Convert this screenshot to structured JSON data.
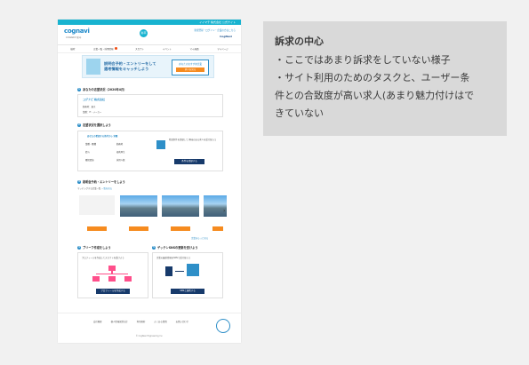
{
  "header": {
    "top_strip": "イイマチ 株式会社 公式サイト",
    "logo": "cognavi",
    "logo_badge": "新卒",
    "logo_sub": "COGNAVI 新卒",
    "info_text": "新規登録・ログイン・企業の方はこちら",
    "right_logo": "CogNavi",
    "nav_items": [
      "検索",
      "企業一覧・採用情報",
      "スカウト",
      "イベント",
      "マイ画面",
      "マイページ"
    ]
  },
  "hero": {
    "line1": "説明会予約・エントリーをして",
    "line2": "選考情報をキャッチしよう",
    "box_label": "あなたのおすすめ企業",
    "button": "求人を見る"
  },
  "sections": {
    "s1": "あなたの志望状況（2020年4月）",
    "s1_company": "コグナビ 株式会社",
    "s1_row1": "勤務地：東京",
    "s1_row2": "業種：IT・メーカー",
    "s2": "志望状況を選択しよう",
    "s2_card_title": "あなたの希望する条件から 求職",
    "s2_items": [
      "業種・職種",
      "勤務地",
      "給与",
      "福利厚生",
      "職場環境",
      "採用人数"
    ],
    "s2_right_text": "希望条件を登録して 興味のある求人を受け取ろう",
    "s2_button": "条件を登録する",
    "s3": "説明会予約・エントリーをしよう",
    "s3_sub": "マッチングする企業一覧",
    "s3_link": "一覧を見る",
    "s3_more": "企業をもっと見る",
    "s4": "ブリーフ作成をしよう",
    "s4_text": "プロフィールを作成してスカウトを受けよう",
    "s4_button": "プロフィールを作成する",
    "s5": "ゲッテンSNSの更新を受けよう",
    "s5_text": "企業の最新情報をSNSで受け取ろう",
    "s5_button": "SNSと連携する"
  },
  "footer": {
    "links": [
      "会社概要",
      "個人情報保護方針",
      "利用規約",
      "よくある質問",
      "お問い合わせ"
    ],
    "copyright": "© CogNavi Engineering Inc."
  },
  "note": {
    "title": "訴求の中心",
    "lines": [
      "・ここではあまり訴求をしていない様子",
      "・サイト利用のためのタスクと、ユーザー条",
      "件との合致度が高い求人(あまり魅力付けはで",
      "きていない"
    ]
  },
  "colors": {
    "primary": "#18b3d0",
    "accent": "#f68b1f",
    "navy": "#173a6b",
    "note_bg": "#d9d9d9"
  }
}
